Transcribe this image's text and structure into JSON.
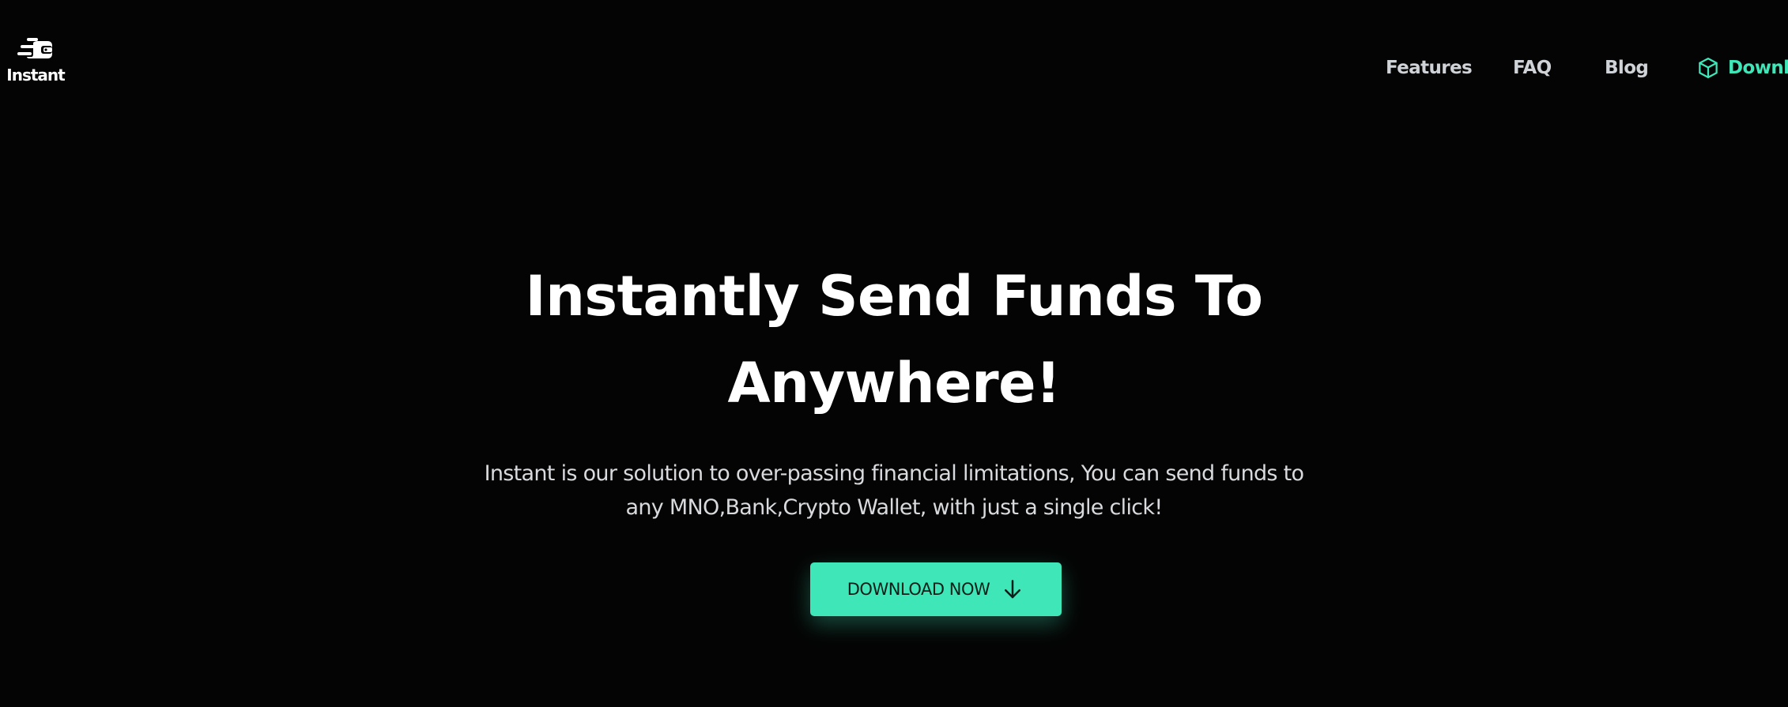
{
  "header": {
    "logo_text": "Instant",
    "logo_icon": "rocket-wallet-logo-icon",
    "nav": {
      "features": "Features",
      "faq": "FAQ",
      "blog": "Blog",
      "download_label": "Downlo",
      "download_icon": "cube-icon"
    }
  },
  "hero": {
    "title_line1": "Instantly Send Funds To",
    "title_line2": "Anywhere!",
    "subtitle_line1": "Instant is our solution to over-passing financial limitations, You can send funds to",
    "subtitle_line2": "any MNO,Bank,Crypto Wallet, with just a single click!",
    "cta_label": "DOWNLOAD NOW",
    "cta_icon": "arrow-down-icon"
  },
  "colors": {
    "background": "#040404",
    "accent": "#3ee6b8",
    "text_primary": "#ffffff",
    "text_secondary": "#cfd2d6"
  }
}
